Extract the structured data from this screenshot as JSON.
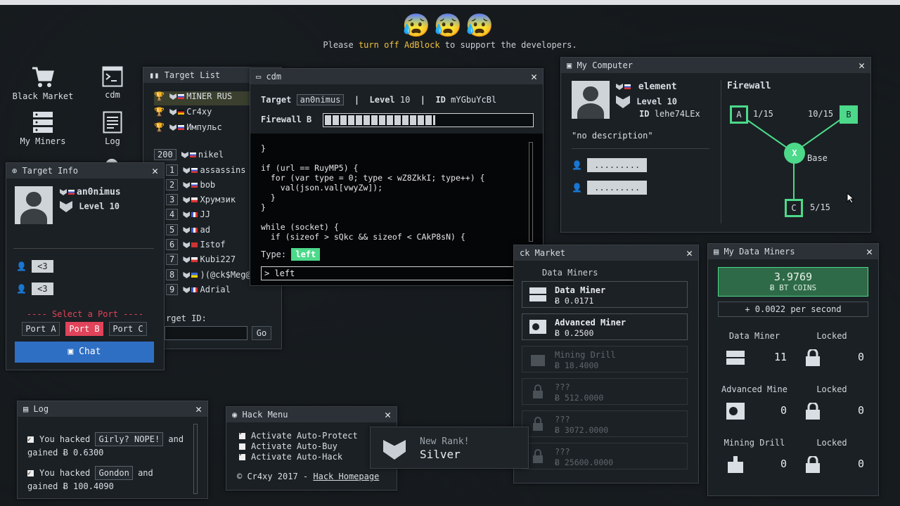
{
  "banner": {
    "emojis": [
      "😰",
      "😰",
      "😰"
    ],
    "text_before": "Please ",
    "text_highlight": "turn off AdBlock",
    "text_after": " to support the developers."
  },
  "desktop": [
    {
      "label": "Black Market",
      "icon": "shopping-cart-icon"
    },
    {
      "label": "cdm",
      "icon": "terminal-icon"
    },
    {
      "label": "My Miners",
      "icon": "server-icon"
    },
    {
      "label": "Log",
      "icon": "document-icon"
    }
  ],
  "target_list": {
    "title": "Target List",
    "top": [
      {
        "name": "MINER RUS"
      },
      {
        "name": "Cr4xy"
      },
      {
        "name": "Импульс"
      }
    ],
    "rows": [
      {
        "rank": "200",
        "name": "nikel"
      },
      {
        "rank": "1",
        "name": "assassins"
      },
      {
        "rank": "2",
        "name": "bob"
      },
      {
        "rank": "3",
        "name": "Хрумзик"
      },
      {
        "rank": "4",
        "name": "JJ"
      },
      {
        "rank": "5",
        "name": "ad"
      },
      {
        "rank": "6",
        "name": "Istof"
      },
      {
        "rank": "7",
        "name": "Kubi227"
      },
      {
        "rank": "8",
        "name": ")(@ck$Meg@"
      },
      {
        "rank": "9",
        "name": "Adrial"
      }
    ],
    "target_id_label": "rget ID:",
    "go_label": "Go"
  },
  "cdm": {
    "title": "cdm",
    "target_label": "Target",
    "target_value": "an0nimus",
    "level_label": "Level",
    "level_value": "10",
    "id_label": "ID",
    "id_value": "mYGbuYcBl",
    "firewall_label": "Firewall B",
    "firewall_progress": 0.53,
    "code": "}\n\nif (url == RuyMP5) {\n  for (var type = 0; type < wZ8ZkkI; type++) {\n    val(json.val[vwyZw]);\n  }\n}\n\nwhile (socket) {\n  if (sizeof > sQkc && sizeof < CAkP8sN) {",
    "type_label": "Type:",
    "type_value": "left",
    "input_value": "> left"
  },
  "target_info": {
    "title": "Target Info",
    "name": "an0nimus",
    "level": "Level 10",
    "messages": [
      "<3",
      "<3"
    ],
    "select_port": "---- Select a Port ----",
    "ports": [
      "Port A",
      "Port B",
      "Port C"
    ],
    "chat": "Chat"
  },
  "my_computer": {
    "title": "My Computer",
    "name": "element",
    "level": "Level 10",
    "id_label": "ID",
    "id_value": "lehe74LEx",
    "description": "\"no description\"",
    "chat_bubbles": [
      ".........",
      "........."
    ],
    "firewall_title": "Firewall",
    "nodes": [
      {
        "id": "A",
        "value": "1/15"
      },
      {
        "id": "B",
        "value": "10/15"
      },
      {
        "id": "C",
        "value": "5/15"
      }
    ],
    "base_label": "Base",
    "base_node": "X"
  },
  "black_market": {
    "title": "ck Market",
    "subtitle": "Data Miners",
    "items": [
      {
        "name": "Data Miner",
        "price": "0.0171",
        "locked": false
      },
      {
        "name": "Advanced Miner",
        "price": "0.2500",
        "locked": false
      },
      {
        "name": "Mining Drill",
        "price": "18.4000",
        "locked": true
      },
      {
        "name": "???",
        "price": "512.0000",
        "locked": true
      },
      {
        "name": "???",
        "price": "3072.0000",
        "locked": true
      },
      {
        "name": "???",
        "price": "25600.0000",
        "locked": true
      }
    ]
  },
  "data_miners": {
    "title": "My Data Miners",
    "balance": "3.9769",
    "currency": "BT COINS",
    "rate": "+ 0.0022 per second",
    "cards": [
      {
        "label": "Data Miner",
        "value": "11"
      },
      {
        "label": "Locked",
        "value": "0"
      },
      {
        "label": "Advanced Mine",
        "value": "0"
      },
      {
        "label": "Locked",
        "value": "0"
      },
      {
        "label": "Mining Drill",
        "value": "0"
      },
      {
        "label": "Locked",
        "value": "0"
      }
    ]
  },
  "log": {
    "title": "Log",
    "entries": [
      {
        "pre": "You hacked",
        "who": "Girly? NOPE!",
        "mid": "and",
        "gained": "gained",
        "amount": "0.6300"
      },
      {
        "pre": "You hacked",
        "who": "Gondon",
        "mid": "and",
        "gained": "gained",
        "amount": "100.4090"
      }
    ]
  },
  "hack_menu": {
    "title": "Hack Menu",
    "options": [
      {
        "label": "Activate Auto-Protect",
        "checked": true
      },
      {
        "label": "Activate Auto-Buy",
        "checked": false
      },
      {
        "label": "Activate Auto-Hack",
        "checked": true
      }
    ],
    "footer": "© Cr4xy 2017 - ",
    "footer_link": "Hack Homepage"
  },
  "rank_toast": {
    "label": "New Rank!",
    "rank": "Silver"
  },
  "colors": {
    "accent_green": "#4cd98a",
    "port_active": "#e0435a",
    "chat_button": "#2e6fc4",
    "balance_bg": "#2f6a48"
  }
}
